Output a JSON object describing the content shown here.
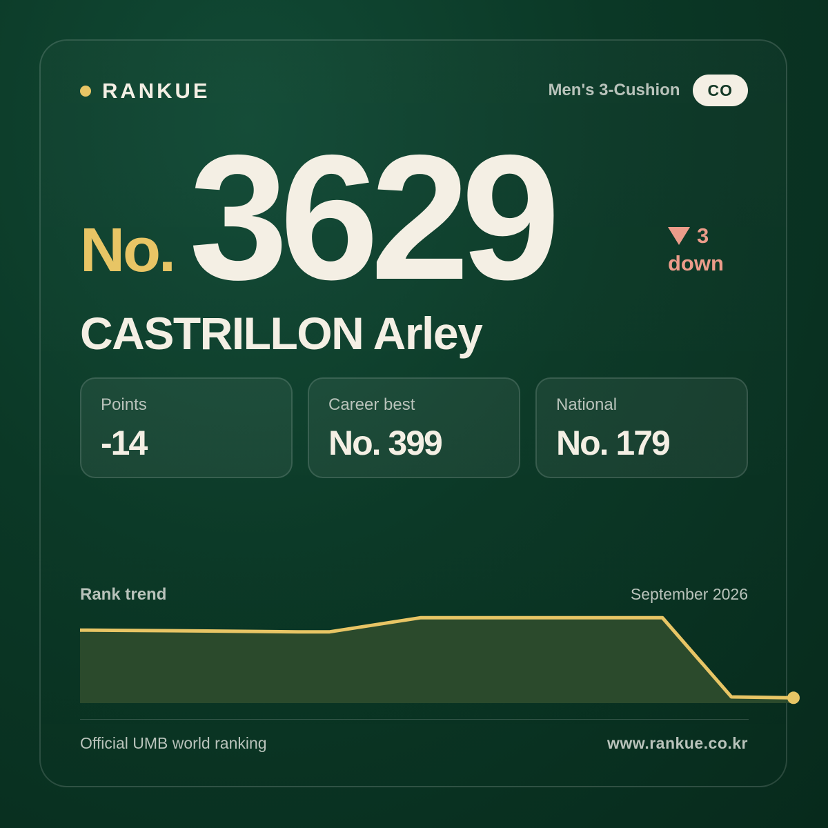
{
  "brand": {
    "name": "RANKUE",
    "dot_color": "#e8c565"
  },
  "category": {
    "label": "Men's 3-Cushion",
    "country": "CO"
  },
  "rank": {
    "prefix": "No.",
    "value": "3629",
    "change_amount": "3",
    "change_label": "down",
    "change_direction": "down",
    "change_color": "#ec9c8a"
  },
  "player": {
    "name": "CASTRILLON Arley"
  },
  "stats": [
    {
      "label": "Points",
      "value": "-14"
    },
    {
      "label": "Career best",
      "value": "No. 399"
    },
    {
      "label": "National",
      "value": "No. 179"
    }
  ],
  "trend": {
    "title": "Rank trend",
    "date": "September 2026"
  },
  "chart_data": {
    "type": "area",
    "title": "Rank trend",
    "grid": false,
    "line_color": "#e8c565",
    "fill_color": "#2b4a2c",
    "y": [
      0.82,
      0.81,
      0.8,
      0.8,
      0.96,
      0.96,
      0.96,
      0.96,
      0.07,
      0.06,
      0.06
    ]
  },
  "footer": {
    "source": "Official UMB world ranking",
    "url": "www.rankue.co.kr"
  },
  "colors": {
    "accent": "#e8c565",
    "text": "#f4efe4",
    "muted": "#b9c3bb",
    "background": "#0b3826"
  }
}
